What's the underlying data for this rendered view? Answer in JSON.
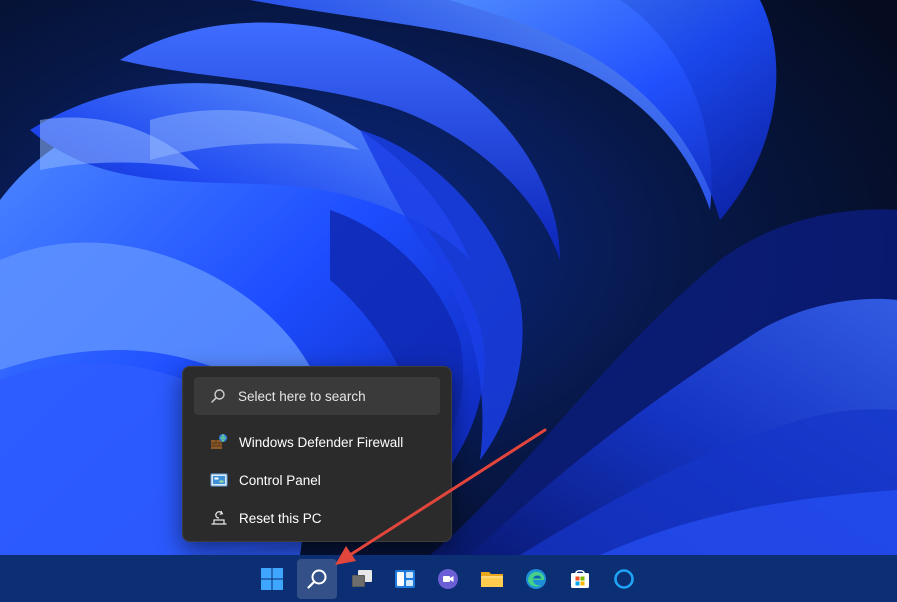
{
  "search_flyout": {
    "placeholder": "Select here to search",
    "results": [
      {
        "label": "Windows Defender Firewall",
        "icon": "firewall-icon"
      },
      {
        "label": "Control Panel",
        "icon": "control-panel-icon"
      },
      {
        "label": "Reset this PC",
        "icon": "reset-pc-icon"
      }
    ]
  },
  "taskbar": {
    "background": "#0c2f73",
    "buttons": [
      {
        "name": "start",
        "icon": "windows-logo-icon"
      },
      {
        "name": "search",
        "icon": "search-icon",
        "active": true
      },
      {
        "name": "task-view",
        "icon": "task-view-icon"
      },
      {
        "name": "widgets",
        "icon": "widgets-icon"
      },
      {
        "name": "teams-chat",
        "icon": "teams-chat-icon"
      },
      {
        "name": "file-explorer",
        "icon": "folder-icon"
      },
      {
        "name": "edge",
        "icon": "edge-icon"
      },
      {
        "name": "microsoft-store",
        "icon": "store-icon"
      },
      {
        "name": "cortana",
        "icon": "cortana-icon"
      }
    ]
  },
  "annotation": {
    "arrow_color": "#e2453c"
  }
}
